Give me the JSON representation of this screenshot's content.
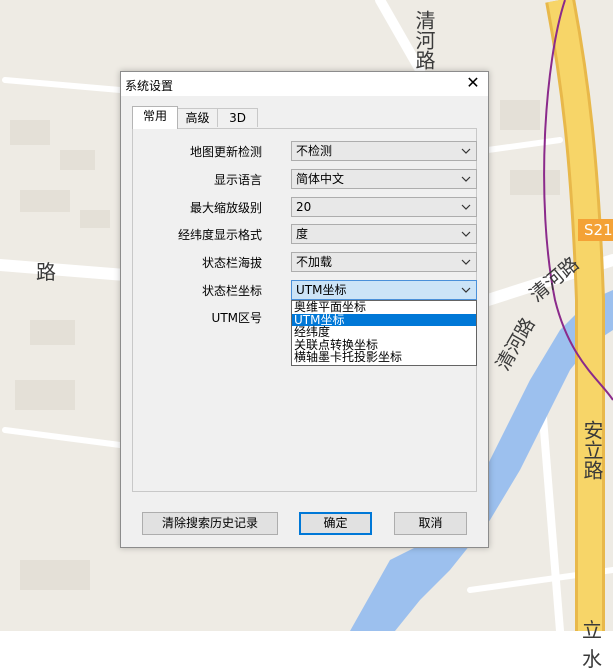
{
  "map": {
    "labels": [
      "清河路",
      "路",
      "清河路",
      "清河路",
      "安立路",
      "立水"
    ],
    "road_badge": "S21",
    "colors": {
      "ground": "#eeebe4",
      "water": "#9cc0ee",
      "highway": "#f7d568",
      "highway_edge": "#e8b84a",
      "road": "#ffffff",
      "boundary": "#8b2a8b"
    }
  },
  "dialog": {
    "title": "系统设置",
    "close_icon": "close-icon",
    "tabs": [
      {
        "label": "常用",
        "active": true
      },
      {
        "label": "高级",
        "active": false
      },
      {
        "label": "3D",
        "active": false
      }
    ],
    "settings": [
      {
        "label": "地图更新检测",
        "value": "不检测"
      },
      {
        "label": "显示语言",
        "value": "简体中文"
      },
      {
        "label": "最大缩放级别",
        "value": "20"
      },
      {
        "label": "经纬度显示格式",
        "value": "度"
      },
      {
        "label": "状态栏海拔",
        "value": "不加载"
      },
      {
        "label": "状态栏坐标",
        "value": "UTM坐标"
      },
      {
        "label": "UTM区号",
        "value": ""
      }
    ],
    "dropdown_options": [
      "奥维平面坐标",
      "UTM坐标",
      "经纬度",
      "关联点转换坐标",
      "横轴墨卡托投影坐标"
    ],
    "dropdown_selected_index": 1,
    "buttons": {
      "clear_history": "清除搜索历史记录",
      "ok": "确定",
      "cancel": "取消"
    },
    "colors": {
      "accent": "#0078d7",
      "focus_bg": "#cce4f7"
    }
  }
}
